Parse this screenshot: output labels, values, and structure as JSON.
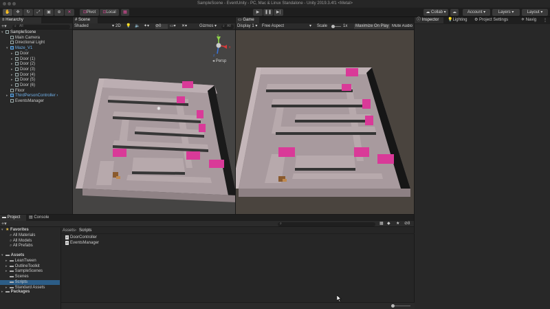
{
  "window": {
    "title": "SampleScene - EventUnity - PC, Mac & Linux Standalone - Unity 2019.3.4f1 <Metal>"
  },
  "toolbar": {
    "pivot_label": "Pivot",
    "local_label": "Local",
    "collab_label": "Collab",
    "account_label": "Account",
    "layers_label": "Layers",
    "layout_label": "Layout"
  },
  "hierarchy": {
    "tab_label": "Hierarchy",
    "search_placeholder": "All",
    "items": [
      {
        "label": "SampleScene",
        "depth": 0,
        "expanded": true,
        "kind": "scene"
      },
      {
        "label": "Main Camera",
        "depth": 1,
        "kind": "obj"
      },
      {
        "label": "Directional Light",
        "depth": 1,
        "kind": "obj"
      },
      {
        "label": "Maze_V1",
        "depth": 1,
        "expanded": true,
        "kind": "prefab"
      },
      {
        "label": "Door",
        "depth": 2,
        "collapsed": true,
        "kind": "obj"
      },
      {
        "label": "Door (1)",
        "depth": 2,
        "collapsed": true,
        "kind": "obj"
      },
      {
        "label": "Door (2)",
        "depth": 2,
        "collapsed": true,
        "kind": "obj"
      },
      {
        "label": "Door (3)",
        "depth": 2,
        "collapsed": true,
        "kind": "obj"
      },
      {
        "label": "Door (4)",
        "depth": 2,
        "collapsed": true,
        "kind": "obj"
      },
      {
        "label": "Door (5)",
        "depth": 2,
        "collapsed": true,
        "kind": "obj"
      },
      {
        "label": "Door (6)",
        "depth": 2,
        "collapsed": true,
        "kind": "obj"
      },
      {
        "label": "Floor",
        "depth": 1,
        "kind": "obj"
      },
      {
        "label": "ThirdPersonController",
        "depth": 1,
        "collapsed": true,
        "kind": "prefab"
      },
      {
        "label": "EventsManager",
        "depth": 1,
        "kind": "obj"
      }
    ]
  },
  "scene": {
    "tab_label": "Scene",
    "shading": "Shaded",
    "mode_2d": "2D",
    "gizmos_label": "Gizmos",
    "search_placeholder": "All",
    "gizmo_label": "Persp",
    "gizmo_axes": {
      "x": "x",
      "y": "y",
      "z": "z"
    }
  },
  "game": {
    "tab_label": "Game",
    "display": "Display 1",
    "aspect": "Free Aspect",
    "scale_label": "Scale",
    "scale_value": "1x",
    "maximize_label": "Maximize On Play",
    "mute_label": "Mute Audio"
  },
  "inspector": {
    "tabs": [
      {
        "label": "Inspector"
      },
      {
        "label": "Lighting"
      },
      {
        "label": "Project Settings"
      },
      {
        "label": "Navig"
      }
    ]
  },
  "project": {
    "tabs": [
      {
        "label": "Project"
      },
      {
        "label": "Console"
      }
    ],
    "favorites": {
      "label": "Favorites",
      "items": [
        "All Materials",
        "All Models",
        "All Prefabs"
      ]
    },
    "assets": {
      "label": "Assets",
      "items": [
        "LeanTween",
        "OutlineToolkit",
        "SampleScenes",
        "Scenes",
        "Scripts",
        "Standard Assets"
      ]
    },
    "packages_label": "Packages",
    "breadcrumb": {
      "root": "Assets",
      "current": "Scripts"
    },
    "files": [
      "DoorController",
      "EventsManager"
    ],
    "hidden_count": "8"
  },
  "colors": {
    "selection": "#2c5d87",
    "prefab_blue": "#5fa4e0",
    "door_magenta": "#d93a98",
    "wall_top": "#b5a6aa"
  }
}
